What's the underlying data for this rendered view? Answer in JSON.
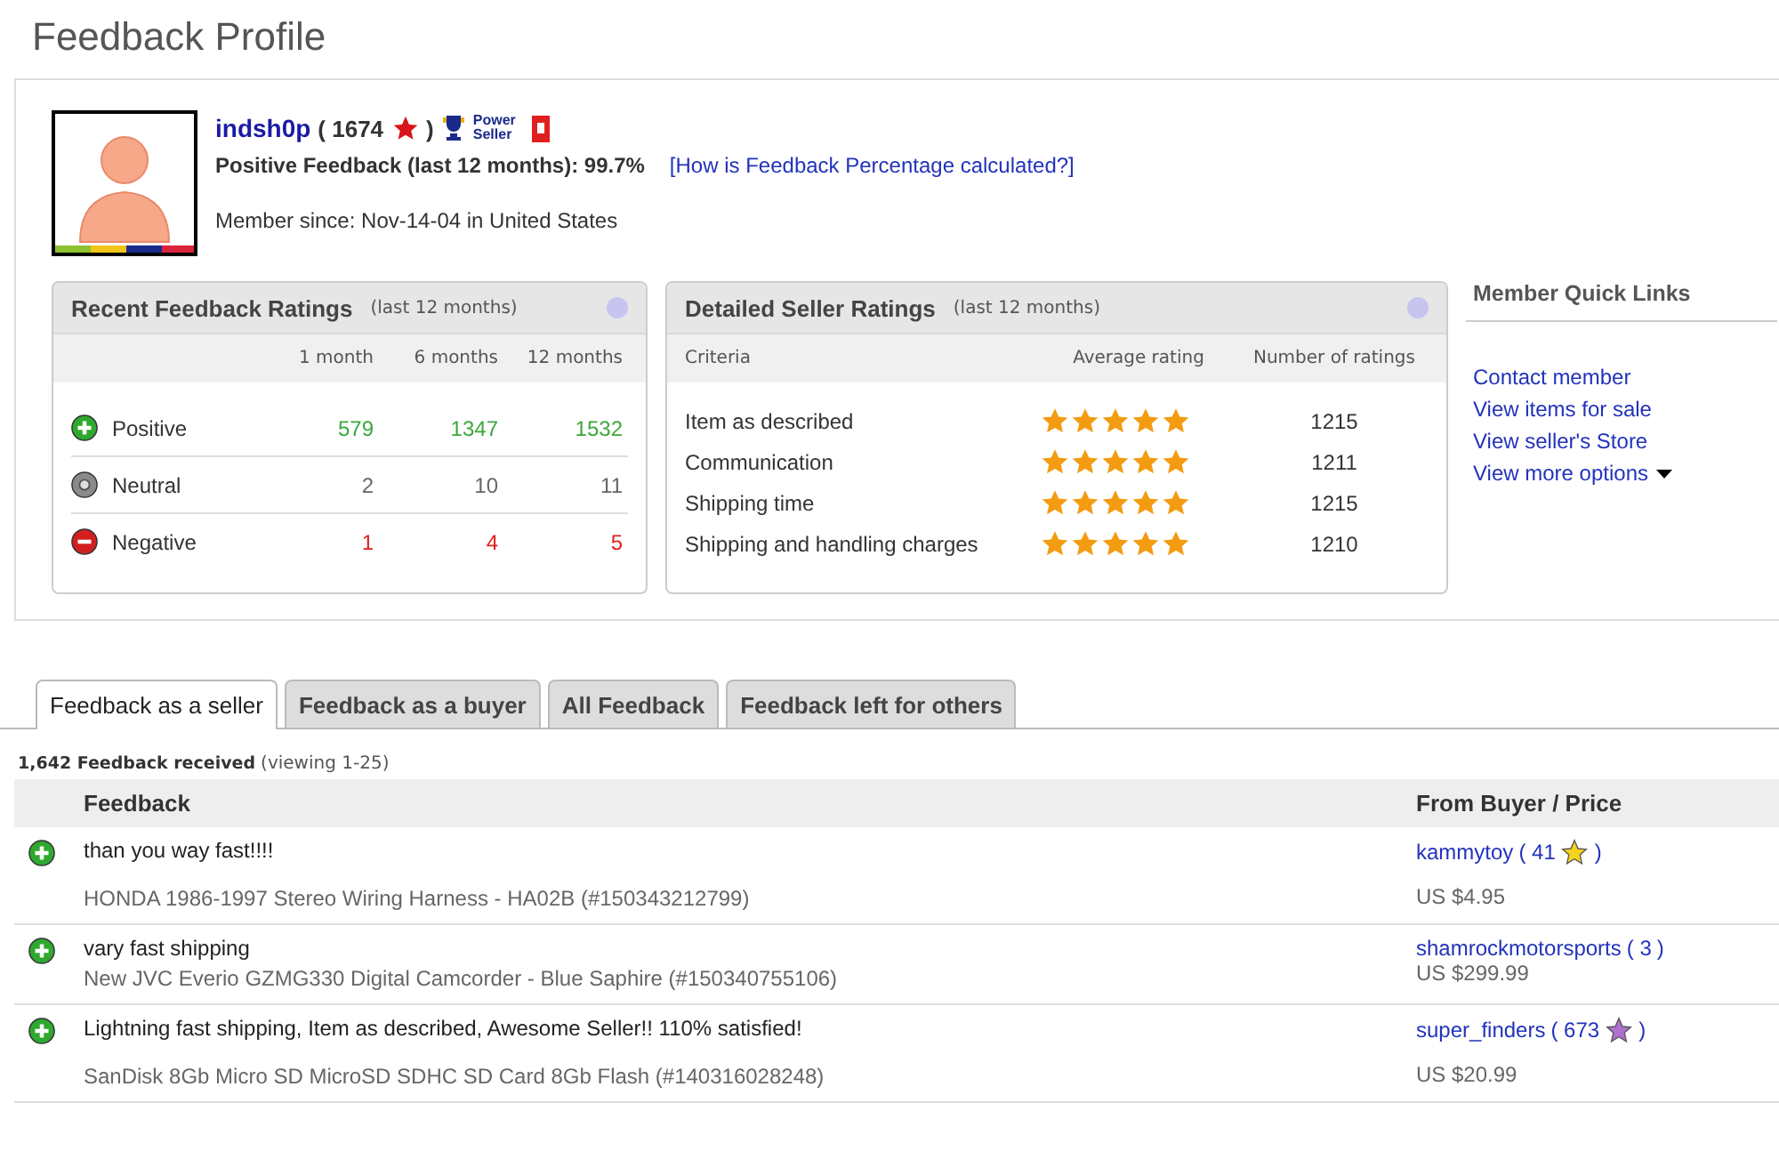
{
  "page_title": "Feedback Profile",
  "profile": {
    "username": "indsh0p",
    "score": "( 1674",
    "score_close": ")",
    "badge": "Power Seller",
    "positive_label": "Positive Feedback (last 12 months): 99.7%",
    "help_link": "[How is Feedback Percentage calculated?]",
    "member_since": "Member since: Nov-14-04 in United States"
  },
  "recent_ratings": {
    "title": "Recent Feedback Ratings",
    "subtitle": "(last 12 months)",
    "columns": [
      "1 month",
      "6 months",
      "12 months"
    ],
    "rows": [
      {
        "kind": "positive",
        "label": "Positive",
        "values": [
          "579",
          "1347",
          "1532"
        ]
      },
      {
        "kind": "neutral",
        "label": "Neutral",
        "values": [
          "2",
          "10",
          "11"
        ]
      },
      {
        "kind": "negative",
        "label": "Negative",
        "values": [
          "1",
          "4",
          "5"
        ]
      }
    ]
  },
  "detailed_ratings": {
    "title": "Detailed Seller Ratings",
    "subtitle": "(last 12 months)",
    "columns": [
      "Criteria",
      "Average rating",
      "Number of ratings"
    ],
    "rows": [
      {
        "criteria": "Item as described",
        "stars": 5,
        "count": "1215"
      },
      {
        "criteria": "Communication",
        "stars": 5,
        "count": "1211"
      },
      {
        "criteria": "Shipping time",
        "stars": 5,
        "count": "1215"
      },
      {
        "criteria": "Shipping and handling charges",
        "stars": 5,
        "count": "1210"
      }
    ]
  },
  "quick_links": {
    "title": "Member Quick Links",
    "links": [
      "Contact member",
      "View items for sale",
      "View seller's Store",
      "View more options"
    ]
  },
  "tabs": [
    {
      "label": "Feedback as a seller",
      "selected": true
    },
    {
      "label": "Feedback as a buyer",
      "selected": false
    },
    {
      "label": "All Feedback",
      "selected": false
    },
    {
      "label": "Feedback left for others",
      "selected": false
    }
  ],
  "summary": {
    "count": "1,642 Feedback received",
    "viewing": "(viewing 1-25)"
  },
  "table": {
    "columns": [
      "Feedback",
      "From Buyer / Price"
    ],
    "rows": [
      {
        "kind": "positive",
        "comment": "than you way fast!!!!",
        "item": "HONDA 1986-1997 Stereo Wiring Harness - HA02B (#150343212799)",
        "buyer": "kammytoy",
        "score": "( 41",
        "close": ")",
        "color": "#f5d31c",
        "price": "US $4.95"
      },
      {
        "kind": "positive",
        "comment": "vary fast shipping",
        "item": "New JVC Everio GZMG330 Digital Camcorder - Blue Saphire (#150340755106)",
        "buyer": "shamrockmotorsports",
        "score": "( 3",
        "close": ")",
        "price": "US $299.99"
      },
      {
        "kind": "positive",
        "comment": "Lightning fast shipping, Item as described, Awesome Seller!! 110% satisfied!",
        "item": "SanDisk 8Gb Micro SD MicroSD SDHC SD Card 8Gb Flash (#140316028248)",
        "buyer": "super_finders",
        "score": "( 673",
        "close": ")",
        "color": "#b070d0",
        "price": "US $20.99"
      }
    ]
  }
}
